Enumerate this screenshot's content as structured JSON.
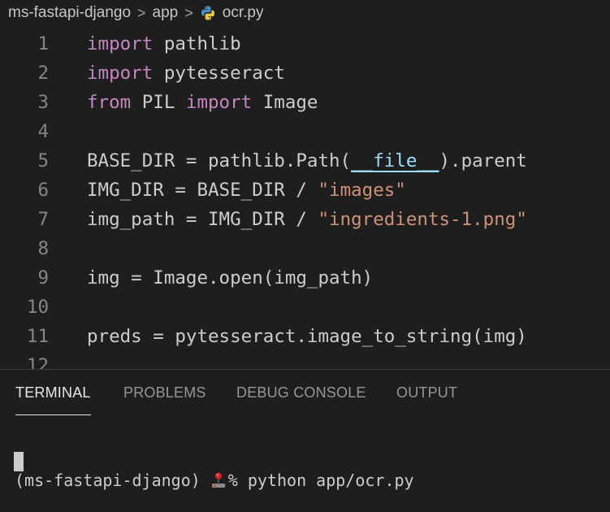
{
  "breadcrumb": {
    "project": "ms-fastapi-django",
    "folder": "app",
    "file": "ocr.py",
    "separator": ">",
    "file_icon": "python-icon"
  },
  "editor": {
    "lines": [
      {
        "num": "1",
        "tokens": [
          {
            "t": "import",
            "c": "kw"
          },
          {
            "t": " pathlib"
          }
        ]
      },
      {
        "num": "2",
        "tokens": [
          {
            "t": "import",
            "c": "kw"
          },
          {
            "t": " pytesseract"
          }
        ]
      },
      {
        "num": "3",
        "tokens": [
          {
            "t": "from",
            "c": "kw"
          },
          {
            "t": " PIL "
          },
          {
            "t": "import",
            "c": "kw"
          },
          {
            "t": " Image"
          }
        ]
      },
      {
        "num": "4",
        "tokens": []
      },
      {
        "num": "5",
        "tokens": [
          {
            "t": "BASE_DIR = pathlib.Path("
          },
          {
            "t": "__file__",
            "c": "dunder"
          },
          {
            "t": ").parent"
          }
        ]
      },
      {
        "num": "6",
        "tokens": [
          {
            "t": "IMG_DIR = BASE_DIR / "
          },
          {
            "t": "\"images\"",
            "c": "str"
          }
        ]
      },
      {
        "num": "7",
        "tokens": [
          {
            "t": "img_path = IMG_DIR / "
          },
          {
            "t": "\"ingredients-1.png\"",
            "c": "str"
          }
        ]
      },
      {
        "num": "8",
        "tokens": []
      },
      {
        "num": "9",
        "tokens": [
          {
            "t": "img = Image.open(img_path)"
          }
        ]
      },
      {
        "num": "10",
        "tokens": []
      },
      {
        "num": "11",
        "tokens": [
          {
            "t": "preds = pytesseract.image_to_string(img)"
          }
        ]
      },
      {
        "num": "12",
        "tokens": []
      }
    ]
  },
  "panel": {
    "tabs": [
      {
        "label": "TERMINAL",
        "active": true
      },
      {
        "label": "PROBLEMS",
        "active": false
      },
      {
        "label": "DEBUG CONSOLE",
        "active": false
      },
      {
        "label": "OUTPUT",
        "active": false
      }
    ]
  },
  "terminal": {
    "prompt_env": "(ms-fastapi-django)",
    "prompt_icon": "joystick-icon",
    "prompt_symbol": "%",
    "command": "python app/ocr.py"
  },
  "colors": {
    "background": "#1e1e1e",
    "keyword": "#c586c0",
    "string": "#ce9178",
    "text": "#d4d4d4",
    "line_number": "#858585"
  }
}
